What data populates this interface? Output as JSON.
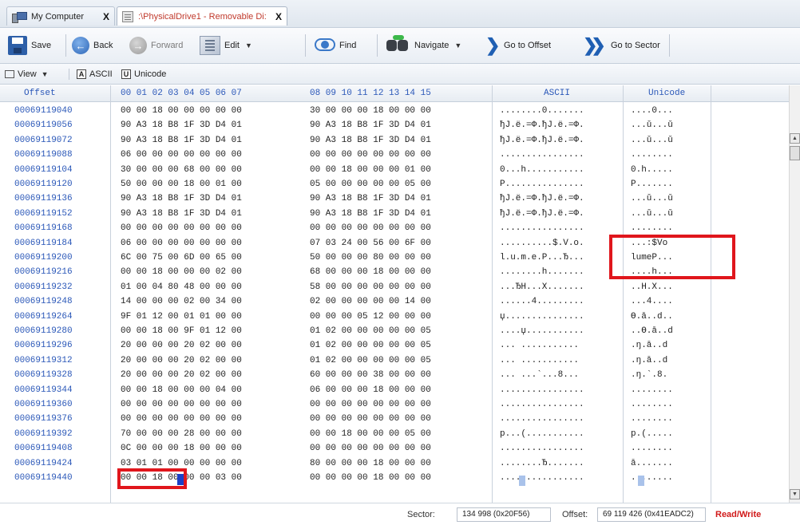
{
  "tabs": [
    {
      "title": "My Computer",
      "icon": "computer-icon",
      "close": "X"
    },
    {
      "title": ":\\PhysicalDrive1 - Removable Di:",
      "icon": "drive-icon",
      "close": "X"
    }
  ],
  "toolbar": {
    "save": "Save",
    "back": "Back",
    "forward": "Forward",
    "edit": "Edit",
    "find": "Find",
    "navigate": "Navigate",
    "go_offset": "Go to Offset",
    "go_sector": "Go to Sector"
  },
  "viewbar": {
    "view": "View",
    "ascii_letter": "A",
    "ascii": "ASCII",
    "unicode_letter": "U",
    "unicode": "Unicode"
  },
  "columns": {
    "offset": "Offset",
    "hex1": "00 01 02 03 04 05 06 07",
    "hex2": "08 09 10 11 12 13 14 15",
    "ascii": "ASCII",
    "unicode": "Unicode"
  },
  "rows": [
    {
      "offset": "00069119040",
      "h1": "00 00 18 00 00 00 00 00",
      "h2": "30 00 00 00 18 00 00 00",
      "ascii": "........0.......",
      "uni": "....0..."
    },
    {
      "offset": "00069119056",
      "h1": "90 A3 18 B8 1F 3D D4 01",
      "h2": "90 A3 18 B8 1F 3D D4 01",
      "ascii": "ђЈ.ё.=Ф.ђЈ.ё.=Ф.",
      "uni": "...ǔ...ǔ"
    },
    {
      "offset": "00069119072",
      "h1": "90 A3 18 B8 1F 3D D4 01",
      "h2": "90 A3 18 B8 1F 3D D4 01",
      "ascii": "ђЈ.ё.=Ф.ђЈ.ё.=Ф.",
      "uni": "...ǔ...ǔ"
    },
    {
      "offset": "00069119088",
      "h1": "06 00 00 00 00 00 00 00",
      "h2": "00 00 00 00 00 00 00 00",
      "ascii": "................",
      "uni": "........"
    },
    {
      "offset": "00069119104",
      "h1": "30 00 00 00 68 00 00 00",
      "h2": "00 00 18 00 00 00 01 00",
      "ascii": "0...h...........",
      "uni": "0.h....."
    },
    {
      "offset": "00069119120",
      "h1": "50 00 00 00 18 00 01 00",
      "h2": "05 00 00 00 00 00 05 00",
      "ascii": "P...............",
      "uni": "P......."
    },
    {
      "offset": "00069119136",
      "h1": "90 A3 18 B8 1F 3D D4 01",
      "h2": "90 A3 18 B8 1F 3D D4 01",
      "ascii": "ђЈ.ё.=Ф.ђЈ.ё.=Ф.",
      "uni": "...ǔ...ǔ"
    },
    {
      "offset": "00069119152",
      "h1": "90 A3 18 B8 1F 3D D4 01",
      "h2": "90 A3 18 B8 1F 3D D4 01",
      "ascii": "ђЈ.ё.=Ф.ђЈ.ё.=Ф.",
      "uni": "...ǔ...ǔ"
    },
    {
      "offset": "00069119168",
      "h1": "00 00 00 00 00 00 00 00",
      "h2": "00 00 00 00 00 00 00 00",
      "ascii": "................",
      "uni": "........"
    },
    {
      "offset": "00069119184",
      "h1": "06 00 00 00 00 00 00 00",
      "h2": "07 03 24 00 56 00 6F 00",
      "ascii": "..........$.V.o.",
      "uni": "...:$Vo"
    },
    {
      "offset": "00069119200",
      "h1": "6C 00 75 00 6D 00 65 00",
      "h2": "50 00 00 00 80 00 00 00",
      "ascii": "l.u.m.e.P...Ђ...",
      "uni": "lumeP..."
    },
    {
      "offset": "00069119216",
      "h1": "00 00 18 00 00 00 02 00",
      "h2": "68 00 00 00 18 00 00 00",
      "ascii": "........h.......",
      "uni": "....h..."
    },
    {
      "offset": "00069119232",
      "h1": "01 00 04 80 48 00 00 00",
      "h2": "58 00 00 00 00 00 00 00",
      "ascii": "...ЂH...X.......",
      "uni": "..H.X..."
    },
    {
      "offset": "00069119248",
      "h1": "14 00 00 00 02 00 34 00",
      "h2": "02 00 00 00 00 00 14 00",
      "ascii": "......4.........",
      "uni": "...4...."
    },
    {
      "offset": "00069119264",
      "h1": "9F 01 12 00 01 01 00 00",
      "h2": "00 00 00 05 12 00 00 00",
      "ascii": "џ...............",
      "uni": "Ɵ.ā..d.."
    },
    {
      "offset": "00069119280",
      "h1": "00 00 18 00 9F 01 12 00",
      "h2": "01 02 00 00 00 00 00 05",
      "ascii": "....џ...........",
      "uni": "..Ɵ.ā..d"
    },
    {
      "offset": "00069119296",
      "h1": "20 00 00 00 20 02 00 00",
      "h2": "01 02 00 00 00 00 00 05",
      "ascii": "... ...........",
      "uni": ".ŋ.ā..d"
    },
    {
      "offset": "00069119312",
      "h1": "20 00 00 00 20 02 00 00",
      "h2": "01 02 00 00 00 00 00 05",
      "ascii": "... ...........",
      "uni": ".ŋ.ā..d"
    },
    {
      "offset": "00069119328",
      "h1": "20 00 00 00 20 02 00 00",
      "h2": "60 00 00 00 38 00 00 00",
      "ascii": "... ...`...8...",
      "uni": ".ŋ.`.8."
    },
    {
      "offset": "00069119344",
      "h1": "00 00 18 00 00 00 04 00",
      "h2": "06 00 00 00 18 00 00 00",
      "ascii": "................",
      "uni": "........"
    },
    {
      "offset": "00069119360",
      "h1": "00 00 00 00 00 00 00 00",
      "h2": "00 00 00 00 00 00 00 00",
      "ascii": "................",
      "uni": "........"
    },
    {
      "offset": "00069119376",
      "h1": "00 00 00 00 00 00 00 00",
      "h2": "00 00 00 00 00 00 00 00",
      "ascii": "................",
      "uni": "........"
    },
    {
      "offset": "00069119392",
      "h1": "70 00 00 00 28 00 00 00",
      "h2": "00 00 18 00 00 00 05 00",
      "ascii": "p...(...........",
      "uni": "p.(....."
    },
    {
      "offset": "00069119408",
      "h1": "0C 00 00 00 18 00 00 00",
      "h2": "00 00 00 00 00 00 00 00",
      "ascii": "................",
      "uni": "........"
    },
    {
      "offset": "00069119424",
      "h1": "03 01 01 00 00 00 00 00",
      "h2": "80 00 00 00 18 00 00 00",
      "ascii": "........Ђ.......",
      "uni": "ā......."
    },
    {
      "offset": "00069119440",
      "h1": "00 00 18 00 00 00 03 00",
      "h2": "00 00 00 00 18 00 00 00",
      "ascii": "................",
      "uni": "........"
    }
  ],
  "status": {
    "sector_label": "Sector:",
    "sector_value": "134 998 (0x20F56)",
    "offset_label": "Offset:",
    "offset_value": "69 119 426 (0x41EADC2)",
    "mode": "Read/Write"
  },
  "colors": {
    "accent": "#2a57b8",
    "highlight": "#e0161c",
    "mode": "#d11a1a"
  }
}
